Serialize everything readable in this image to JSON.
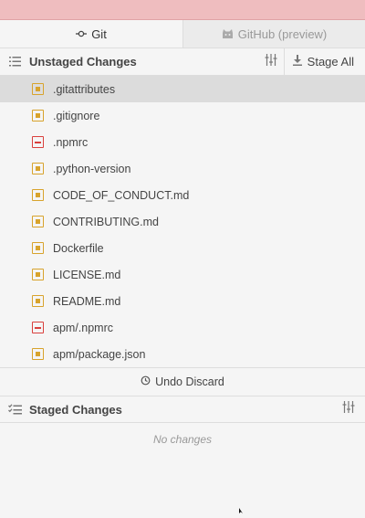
{
  "tabs": [
    {
      "label": "Git",
      "icon": "git-commit-icon",
      "active": true
    },
    {
      "label": "GitHub (preview)",
      "icon": "github-icon",
      "active": false
    }
  ],
  "unstaged": {
    "title": "Unstaged Changes",
    "stage_all_label": "Stage All",
    "files": [
      {
        "name": ".gitattributes",
        "status": "modified",
        "selected": true
      },
      {
        "name": ".gitignore",
        "status": "modified"
      },
      {
        "name": ".npmrc",
        "status": "deleted"
      },
      {
        "name": ".python-version",
        "status": "modified"
      },
      {
        "name": "CODE_OF_CONDUCT.md",
        "status": "modified"
      },
      {
        "name": "CONTRIBUTING.md",
        "status": "modified"
      },
      {
        "name": "Dockerfile",
        "status": "modified"
      },
      {
        "name": "LICENSE.md",
        "status": "modified"
      },
      {
        "name": "README.md",
        "status": "modified"
      },
      {
        "name": "apm/.npmrc",
        "status": "deleted"
      },
      {
        "name": "apm/package.json",
        "status": "modified"
      }
    ]
  },
  "undo_discard_label": "Undo Discard",
  "staged": {
    "title": "Staged Changes",
    "empty_label": "No changes"
  },
  "colors": {
    "modified": "#d8a32c",
    "deleted": "#d9403d",
    "notification_strip": "#efbdbf"
  }
}
